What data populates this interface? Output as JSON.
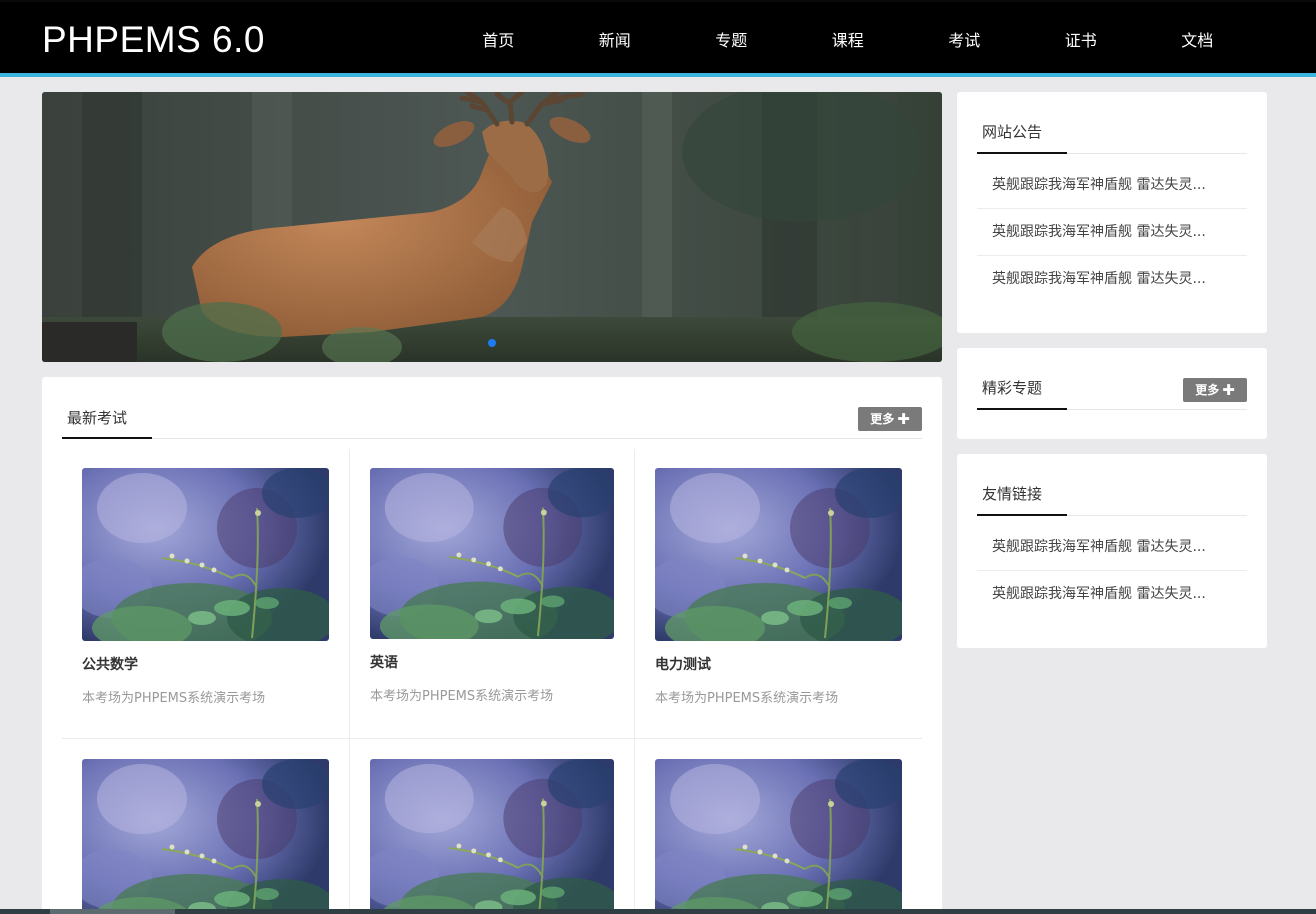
{
  "header": {
    "brand": "PHPEMS 6.0",
    "nav": [
      "首页",
      "新闻",
      "专题",
      "课程",
      "考试",
      "证书",
      "文档"
    ]
  },
  "exams": {
    "title": "最新考试",
    "more_label": "更多",
    "items": [
      {
        "title": "公共数学",
        "desc": "本考场为PHPEMS系统演示考场"
      },
      {
        "title": "英语",
        "desc": "本考场为PHPEMS系统演示考场"
      },
      {
        "title": "电力测试",
        "desc": "本考场为PHPEMS系统演示考场"
      }
    ]
  },
  "notice": {
    "title": "网站公告",
    "items": [
      "英舰跟踪我海军神盾舰 雷达失灵...",
      "英舰跟踪我海军神盾舰 雷达失灵...",
      "英舰跟踪我海军神盾舰 雷达失灵..."
    ]
  },
  "topics": {
    "title": "精彩专题",
    "more_label": "更多"
  },
  "links": {
    "title": "友情链接",
    "items": [
      "英舰跟踪我海军神盾舰 雷达失灵...",
      "英舰跟踪我海军神盾舰 雷达失灵..."
    ]
  },
  "colors": {
    "accent_bar": "#3bb4e0",
    "carousel_dot": "#1e7bf2",
    "more_button": "#7a7a7a"
  }
}
